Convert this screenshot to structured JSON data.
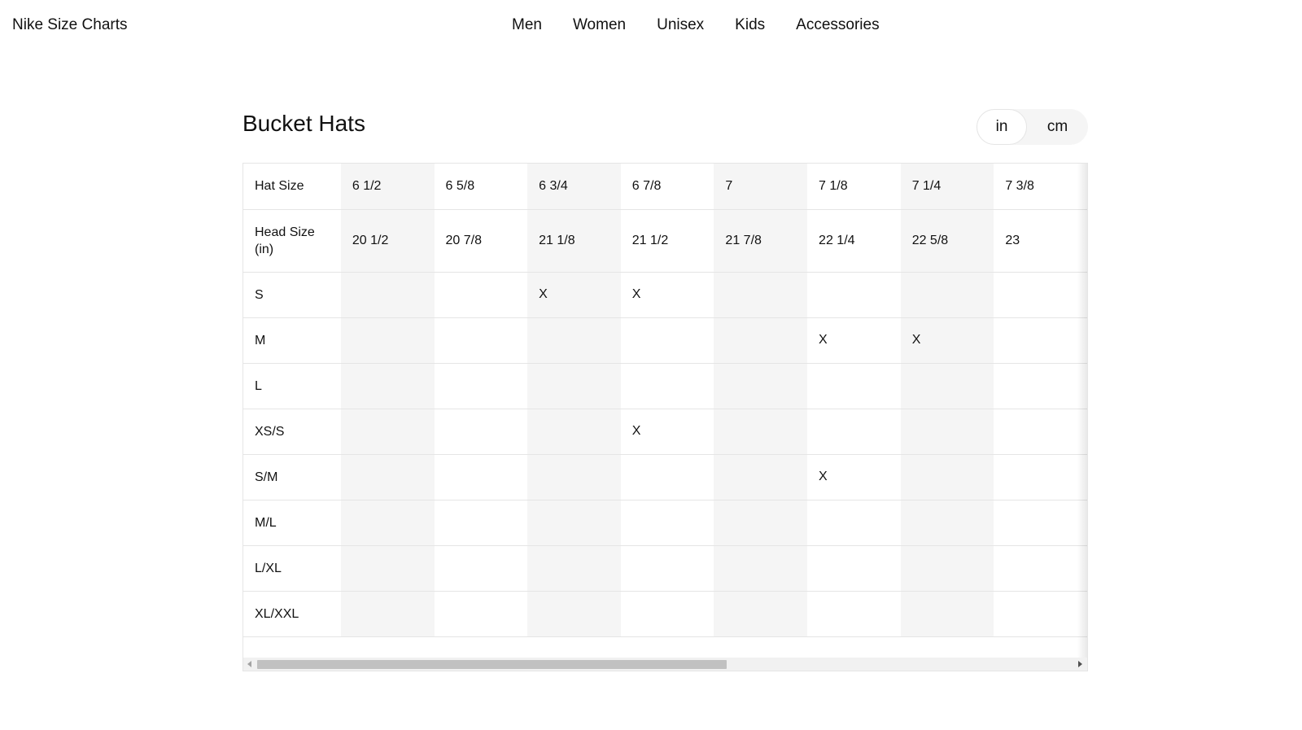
{
  "brand": "Nike Size Charts",
  "nav": [
    "Men",
    "Women",
    "Unisex",
    "Kids",
    "Accessories"
  ],
  "page_title": "Bucket Hats",
  "unit_toggle": {
    "options": [
      "in",
      "cm"
    ],
    "selected": "in"
  },
  "table": {
    "rows": [
      {
        "label": "Hat Size",
        "cells": [
          "6 1/2",
          "6 5/8",
          "6 3/4",
          "6 7/8",
          "7",
          "7 1/8",
          "7 1/4",
          "7 3/8"
        ]
      },
      {
        "label": "Head Size (in)",
        "cells": [
          "20 1/2",
          "20 7/8",
          "21 1/8",
          "21 1/2",
          "21 7/8",
          "22 1/4",
          "22 5/8",
          "23"
        ]
      },
      {
        "label": "S",
        "cells": [
          "",
          "",
          "X",
          "X",
          "",
          "",
          "",
          ""
        ]
      },
      {
        "label": "M",
        "cells": [
          "",
          "",
          "",
          "",
          "",
          "X",
          "X",
          ""
        ]
      },
      {
        "label": "L",
        "cells": [
          "",
          "",
          "",
          "",
          "",
          "",
          "",
          ""
        ]
      },
      {
        "label": "XS/S",
        "cells": [
          "",
          "",
          "",
          "X",
          "",
          "",
          "",
          ""
        ]
      },
      {
        "label": "S/M",
        "cells": [
          "",
          "",
          "",
          "",
          "",
          "X",
          "",
          ""
        ]
      },
      {
        "label": "M/L",
        "cells": [
          "",
          "",
          "",
          "",
          "",
          "",
          "",
          ""
        ]
      },
      {
        "label": "L/XL",
        "cells": [
          "",
          "",
          "",
          "",
          "",
          "",
          "",
          ""
        ]
      },
      {
        "label": "XL/XXL",
        "cells": [
          "",
          "",
          "",
          "",
          "",
          "",
          "",
          ""
        ]
      }
    ]
  },
  "colors": {
    "shaded_column": "#f5f5f5",
    "border": "#e5e5e5",
    "text": "#111111",
    "scroll_thumb": "#c1c1c1"
  }
}
